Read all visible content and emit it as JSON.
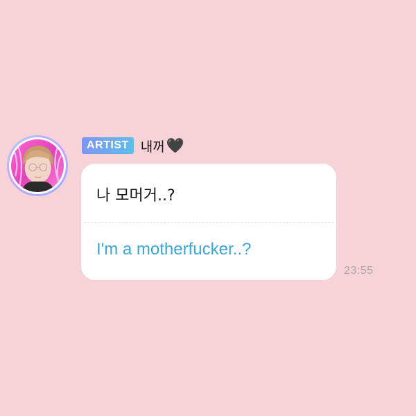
{
  "colors": {
    "background": "#f7d3d7",
    "badge_gradient_start": "#7f95f2",
    "badge_gradient_end": "#5fbde8",
    "translation_text": "#3aa6d8",
    "timestamp_text": "#a8a8a8"
  },
  "message": {
    "sender_badge": "ARTIST",
    "sender_name": "내꺼",
    "sender_icon": "black-heart-icon",
    "sender_icon_glyph": "🖤",
    "avatar_icon": "user-avatar",
    "original_text": "나 모머거..?",
    "translated_text": "I'm a motherfucker..?",
    "timestamp": "23:55"
  }
}
